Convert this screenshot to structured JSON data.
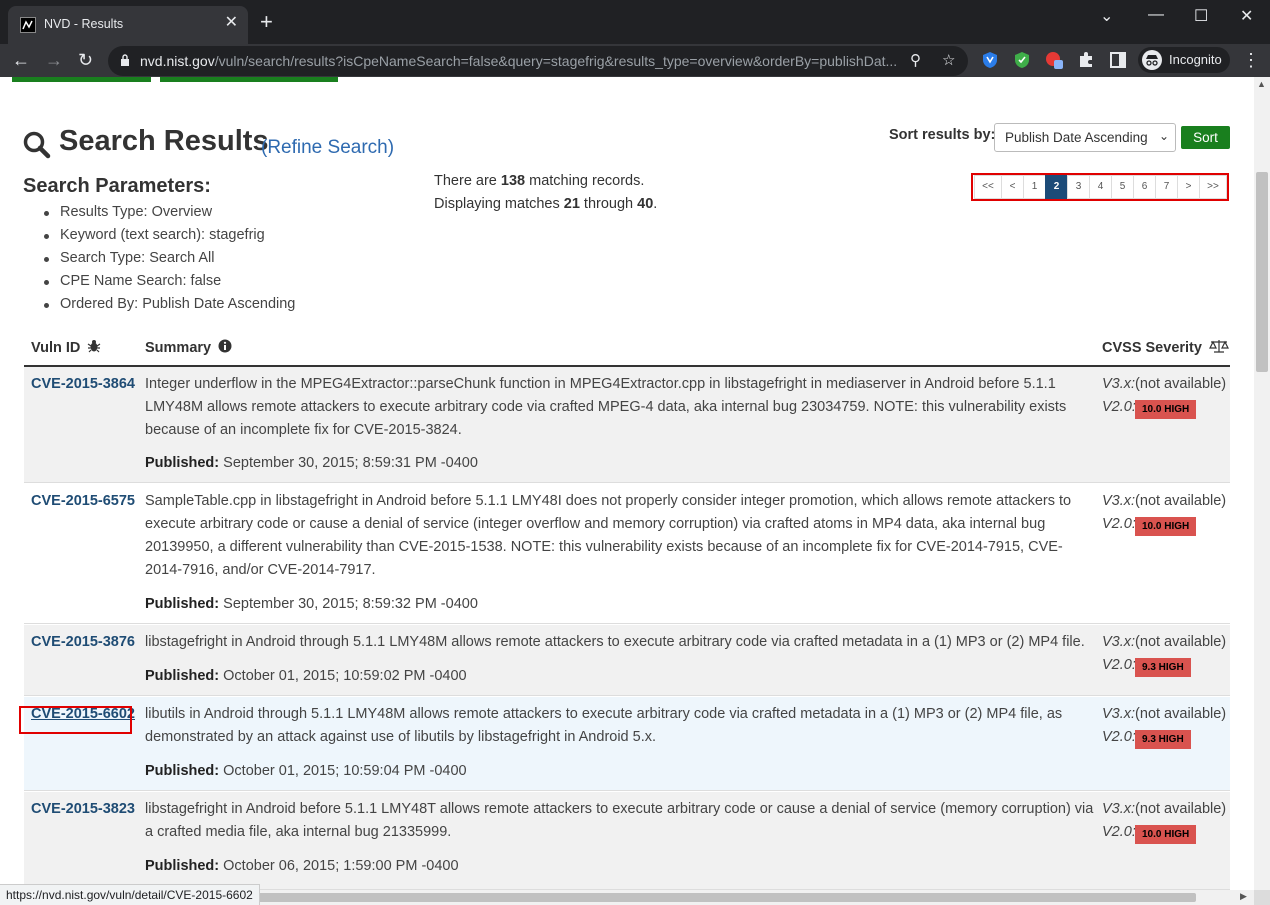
{
  "browser": {
    "tab_title": "NVD - Results",
    "tab_close": "✕",
    "new_tab": "+",
    "url_host": "nvd.nist.gov",
    "url_path": "/vuln/search/results?isCpeNameSearch=false&query=stagefrig&results_type=overview&orderBy=publishDat...",
    "incognito_label": "Incognito",
    "status_url": "https://nvd.nist.gov/vuln/detail/CVE-2015-6602"
  },
  "header": {
    "title": "Search Results",
    "refine": "(Refine Search)"
  },
  "params": {
    "title": "Search Parameters:",
    "items": [
      "Results Type: Overview",
      "Keyword (text search): stagefrig",
      "Search Type: Search All",
      "CPE Name Search: false",
      "Ordered By: Publish Date Ascending"
    ]
  },
  "counts": {
    "prefix": "There are ",
    "total": "138",
    "suffix": " matching records.",
    "disp_prefix": "Displaying matches ",
    "from": "21",
    "through": " through ",
    "to": "40",
    "end": "."
  },
  "sort": {
    "label": "Sort results by:",
    "selected": "Publish Date Ascending",
    "button": "Sort"
  },
  "pagination": {
    "first": "<<",
    "prev": "<",
    "pages": [
      "1",
      "2",
      "3",
      "4",
      "5",
      "6",
      "7"
    ],
    "active": "2",
    "next": ">",
    "last": ">>"
  },
  "table": {
    "col_vuln_id": "Vuln ID",
    "col_summary": "Summary",
    "col_cvss": "CVSS Severity",
    "published_label": "Published:",
    "v3_label": "V3.x:",
    "v2_label": "V2.0:",
    "not_available": "(not available)",
    "rows": [
      {
        "id": "CVE-2015-3864",
        "summary": "Integer underflow in the MPEG4Extractor::parseChunk function in MPEG4Extractor.cpp in libstagefright in mediaserver in Android before 5.1.1 LMY48M allows remote attackers to execute arbitrary code via crafted MPEG-4 data, aka internal bug 23034759. NOTE: this vulnerability exists because of an incomplete fix for CVE-2015-3824.",
        "published": "September 30, 2015; 8:59:31 PM -0400",
        "v2": "10.0 HIGH"
      },
      {
        "id": "CVE-2015-6575",
        "summary": "SampleTable.cpp in libstagefright in Android before 5.1.1 LMY48I does not properly consider integer promotion, which allows remote attackers to execute arbitrary code or cause a denial of service (integer overflow and memory corruption) via crafted atoms in MP4 data, aka internal bug 20139950, a different vulnerability than CVE-2015-1538. NOTE: this vulnerability exists because of an incomplete fix for CVE-2014-7915, CVE-2014-7916, and/or CVE-2014-7917.",
        "published": "September 30, 2015; 8:59:32 PM -0400",
        "v2": "10.0 HIGH"
      },
      {
        "id": "CVE-2015-3876",
        "summary": "libstagefright in Android through 5.1.1 LMY48M allows remote attackers to execute arbitrary code via crafted metadata in a (1) MP3 or (2) MP4 file.",
        "published": "October 01, 2015; 10:59:02 PM -0400",
        "v2": "9.3 HIGH"
      },
      {
        "id": "CVE-2015-6602",
        "summary": "libutils in Android through 5.1.1 LMY48M allows remote attackers to execute arbitrary code via crafted metadata in a (1) MP3 or (2) MP4 file, as demonstrated by an attack against use of libutils by libstagefright in Android 5.x.",
        "published": "October 01, 2015; 10:59:04 PM -0400",
        "v2": "9.3 HIGH"
      },
      {
        "id": "CVE-2015-3823",
        "summary": "libstagefright in Android before 5.1.1 LMY48T allows remote attackers to execute arbitrary code or cause a denial of service (memory corruption) via a crafted media file, aka internal bug 21335999.",
        "published": "October 06, 2015; 1:59:00 PM -0400",
        "v2": "10.0 HIGH"
      }
    ]
  },
  "colors": {
    "nvd_green": "#197f1e",
    "link_blue": "#1f4c74",
    "high_badge": "#d9534f",
    "annotation_red": "#e00000"
  }
}
